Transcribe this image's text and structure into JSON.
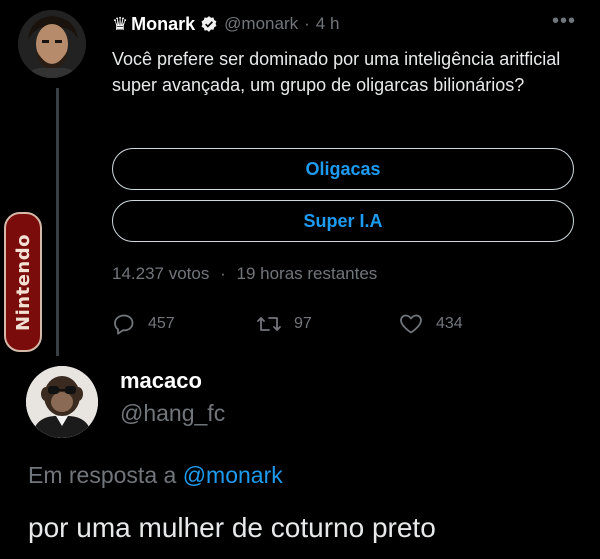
{
  "tweet": {
    "crown_icon": "♛",
    "author_name": "Monark",
    "verified_icon": "verified-badge",
    "handle": "@monark",
    "separator": "·",
    "time": "4 h",
    "more_icon": "•••",
    "text": "Você prefere ser dominado por uma inteligência aritficial super avançada, um grupo de oligarcas bilionários?",
    "poll": {
      "options": [
        "Oligacas",
        "Super I.A"
      ],
      "votes": "14.237 votos",
      "separator": "·",
      "time_left": "19 horas restantes"
    },
    "actions": {
      "replies": "457",
      "retweets": "97",
      "likes": "434"
    }
  },
  "overlay_logo": "Nintendo",
  "reply": {
    "author_name": "macaco",
    "handle": "@hang_fc",
    "reply_prefix": "Em resposta a",
    "mention": "@monark",
    "text": "por uma mulher de coturno preto"
  },
  "colors": {
    "background": "#000000",
    "text": "#e7e9ea",
    "muted": "#71767b",
    "accent": "#1d9bf0"
  }
}
